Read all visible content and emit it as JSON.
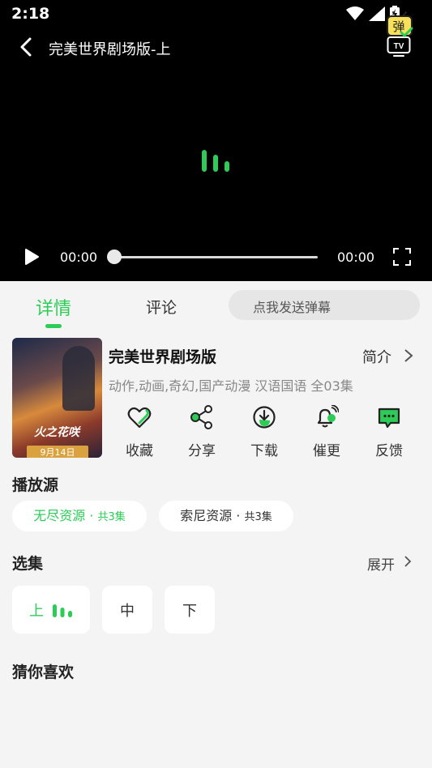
{
  "status": {
    "time": "2:18"
  },
  "player": {
    "title": "完美世界剧场版-上",
    "current_time": "00:00",
    "total_time": "00:00",
    "progress": 0
  },
  "tabs": {
    "detail": "详情",
    "comment": "评论"
  },
  "danmaku": {
    "placeholder": "点我发送弹幕",
    "icon_text": "弹"
  },
  "show": {
    "poster_logo": "火之花咲",
    "poster_date": "9月14日",
    "title": "完美世界剧场版",
    "intro_label": "简介",
    "meta": "动作,动画,奇幻,国产动漫 汉语国语 全03集"
  },
  "actions": [
    {
      "label": "收藏",
      "icon": "heart-icon"
    },
    {
      "label": "分享",
      "icon": "share-icon"
    },
    {
      "label": "下载",
      "icon": "download-icon"
    },
    {
      "label": "催更",
      "icon": "bell-icon"
    },
    {
      "label": "反馈",
      "icon": "feedback-icon"
    }
  ],
  "sources": {
    "title": "播放源",
    "items": [
      {
        "name": "无尽资源 · ",
        "count": "共3集",
        "active": true
      },
      {
        "name": "索尼资源 · ",
        "count": "共3集",
        "active": false
      }
    ]
  },
  "episodes": {
    "title": "选集",
    "expand_label": "展开",
    "items": [
      {
        "label": "上",
        "playing": true
      },
      {
        "label": "中",
        "playing": false
      },
      {
        "label": "下",
        "playing": false
      }
    ]
  },
  "recommend": {
    "title": "猜你喜欢"
  },
  "colors": {
    "accent": "#2ccc57",
    "player_bg": "#000000",
    "page_bg": "#f4f4f4"
  }
}
